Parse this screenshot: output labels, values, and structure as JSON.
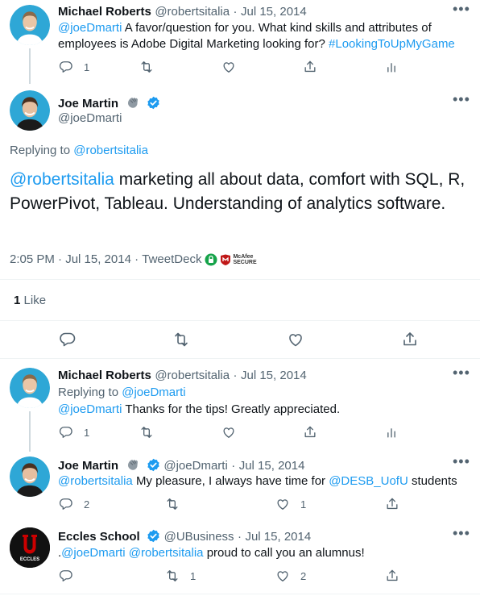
{
  "tweet1": {
    "name": "Michael Roberts",
    "handle": "@robertsitalia",
    "sep": "·",
    "date": "Jul 15, 2014",
    "mention": "@joeDmarti",
    "text": "A favor/question for you. What kind skills and attributes of employees is Adobe Digital Marketing looking for?",
    "hashtag": "#LookingToUpMyGame",
    "reply_count": "1"
  },
  "main": {
    "name": "Joe Martin",
    "handle": "@joeDmarti",
    "replying_label": "Replying to",
    "replying_to": "@robertsitalia",
    "mention": "@robertsitalia",
    "text": "marketing all about data, comfort with SQL, R, PowerPivot, Tableau. Understanding of analytics software.",
    "time": "2:05 PM · Jul 15, 2014 · ",
    "source": "TweetDeck",
    "mcafee_top": "McAfee",
    "mcafee_bottom": "SECURE",
    "like_count": "1",
    "like_label": "Like"
  },
  "tweet3": {
    "name": "Michael Roberts",
    "handle": "@robertsitalia",
    "sep": "·",
    "date": "Jul 15, 2014",
    "replying_label": "Replying to",
    "replying_to": "@joeDmarti",
    "mention": "@joeDmarti",
    "text": "Thanks for the tips! Greatly appreciated.",
    "reply_count": "1"
  },
  "tweet4": {
    "name": "Joe Martin",
    "handle": "@joeDmarti",
    "sep": "·",
    "date": "Jul 15, 2014",
    "mention": "@robertsitalia",
    "text1": "My pleasure, I always have time for",
    "mention2": "@DESB_UofU",
    "text2": "students",
    "reply_count": "2",
    "like_count": "1"
  },
  "tweet5": {
    "name": "Eccles School",
    "handle": "@UBusiness",
    "sep": "·",
    "date": "Jul 15, 2014",
    "prefix": ".",
    "mention1": "@joeDmarti",
    "mention2": "@robertsitalia",
    "text": "proud to call you an alumnus!",
    "avatar_label": "ECCLES",
    "retweet_count": "1",
    "like_count": "2"
  },
  "icons": {
    "reply": "reply-icon",
    "retweet": "retweet-icon",
    "like": "heart-icon",
    "share": "share-icon",
    "analytics": "analytics-icon",
    "more": "more-icon",
    "verified": "verified-badge-icon",
    "emoji": "waving-hand-icon"
  },
  "colors": {
    "link": "#1d9bf0",
    "grey": "#536471",
    "divider": "#eff3f4",
    "avatar_bg": "#2ea7d6"
  }
}
